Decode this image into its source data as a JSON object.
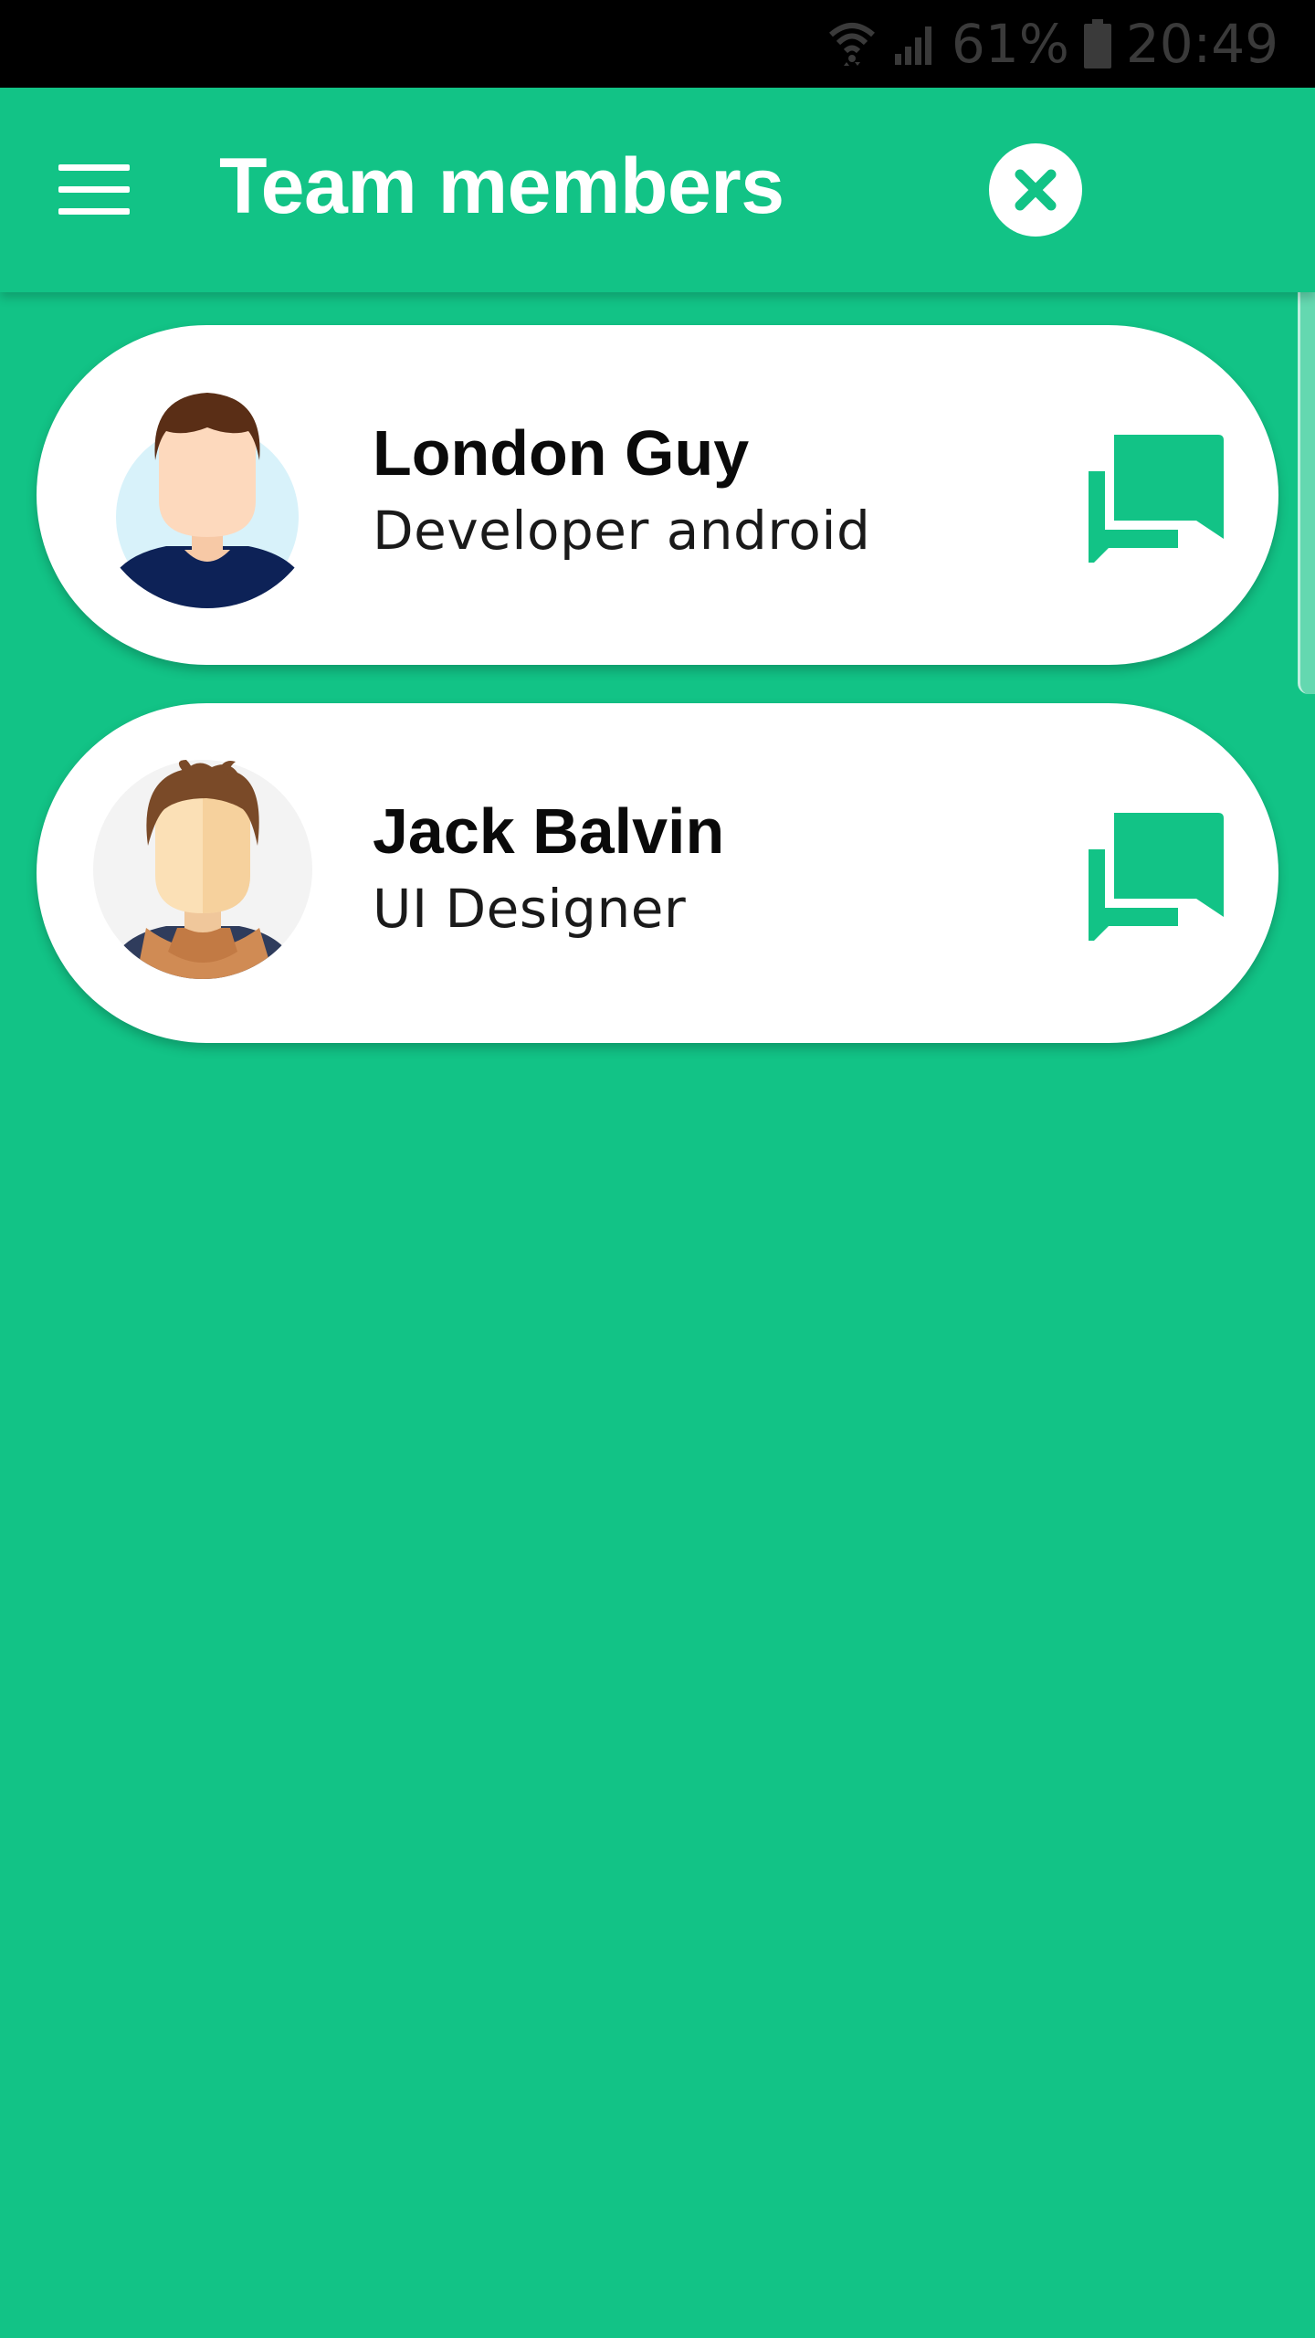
{
  "status_bar": {
    "battery_percent": "61%",
    "time": "20:49",
    "icons": [
      "wifi-icon",
      "signal-icon",
      "battery-icon"
    ]
  },
  "app_bar": {
    "title": "Team members",
    "menu_icon": "hamburger-menu-icon",
    "close_icon": "close-icon"
  },
  "members": [
    {
      "name": "London Guy",
      "role": "Developer android",
      "avatar_icon": "avatar-male-short-hair-icon",
      "action_icon": "chat-icon"
    },
    {
      "name": "Jack Balvin",
      "role": "UI Designer",
      "avatar_icon": "avatar-male-scarf-icon",
      "action_icon": "chat-icon"
    }
  ],
  "colors": {
    "primary": "#12c386",
    "card": "#ffffff",
    "status_bar": "#000000"
  }
}
